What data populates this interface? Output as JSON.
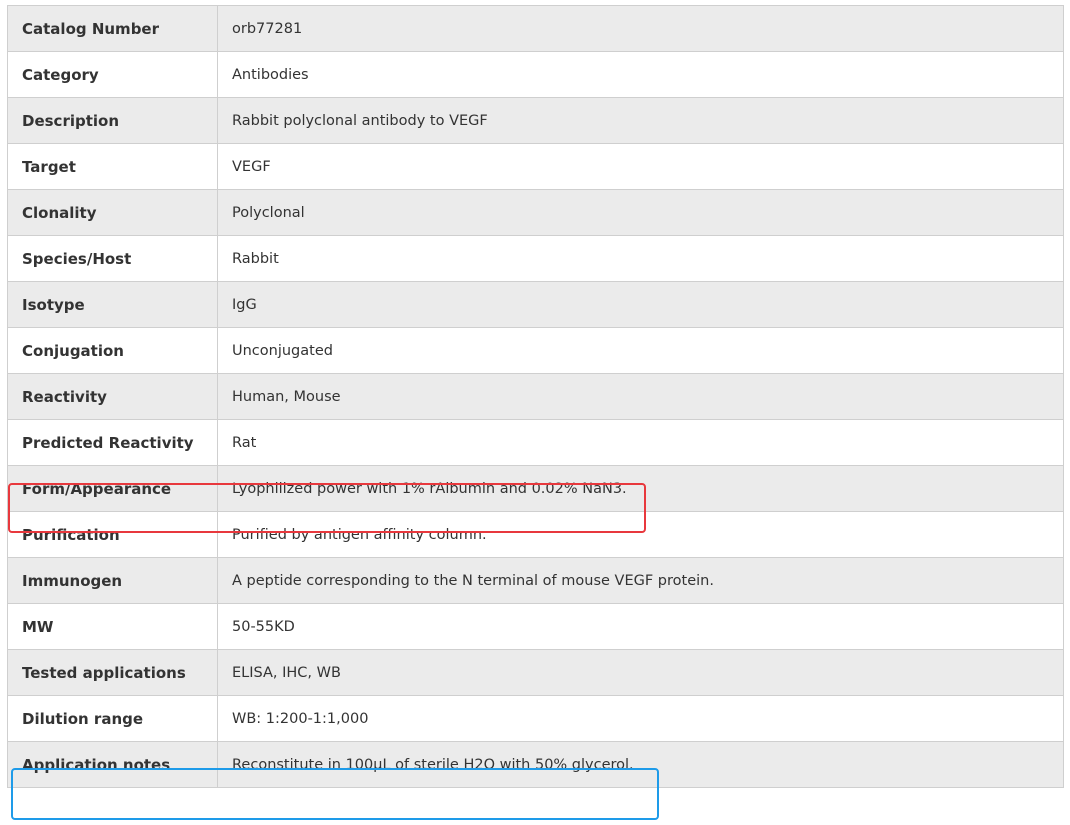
{
  "rows": [
    {
      "label": "Catalog Number",
      "value": "orb77281"
    },
    {
      "label": "Category",
      "value": "Antibodies"
    },
    {
      "label": "Description",
      "value": "Rabbit polyclonal antibody to VEGF"
    },
    {
      "label": "Target",
      "value": "VEGF"
    },
    {
      "label": "Clonality",
      "value": "Polyclonal"
    },
    {
      "label": "Species/Host",
      "value": "Rabbit"
    },
    {
      "label": "Isotype",
      "value": "IgG"
    },
    {
      "label": "Conjugation",
      "value": "Unconjugated"
    },
    {
      "label": "Reactivity",
      "value": "Human, Mouse"
    },
    {
      "label": "Predicted Reactivity",
      "value": "Rat"
    },
    {
      "label": "Form/Appearance",
      "value": "Lyophilized power with 1% rAlbumin and 0.02% NaN3."
    },
    {
      "label": "Purification",
      "value": "Purified by antigen affinity column."
    },
    {
      "label": "Immunogen",
      "value": "A peptide corresponding to the N terminal of mouse VEGF protein."
    },
    {
      "label": "MW",
      "value": "50-55KD"
    },
    {
      "label": "Tested applications",
      "value": "ELISA, IHC, WB"
    },
    {
      "label": "Dilution range",
      "value": "WB: 1:200-1:1,000"
    },
    {
      "label": "Application notes",
      "value": "Reconstitute in 100µL of sterile H2O with 50% glycerol."
    }
  ],
  "highlights": {
    "red_color": "#e8383d",
    "blue_color": "#1e9be9"
  }
}
